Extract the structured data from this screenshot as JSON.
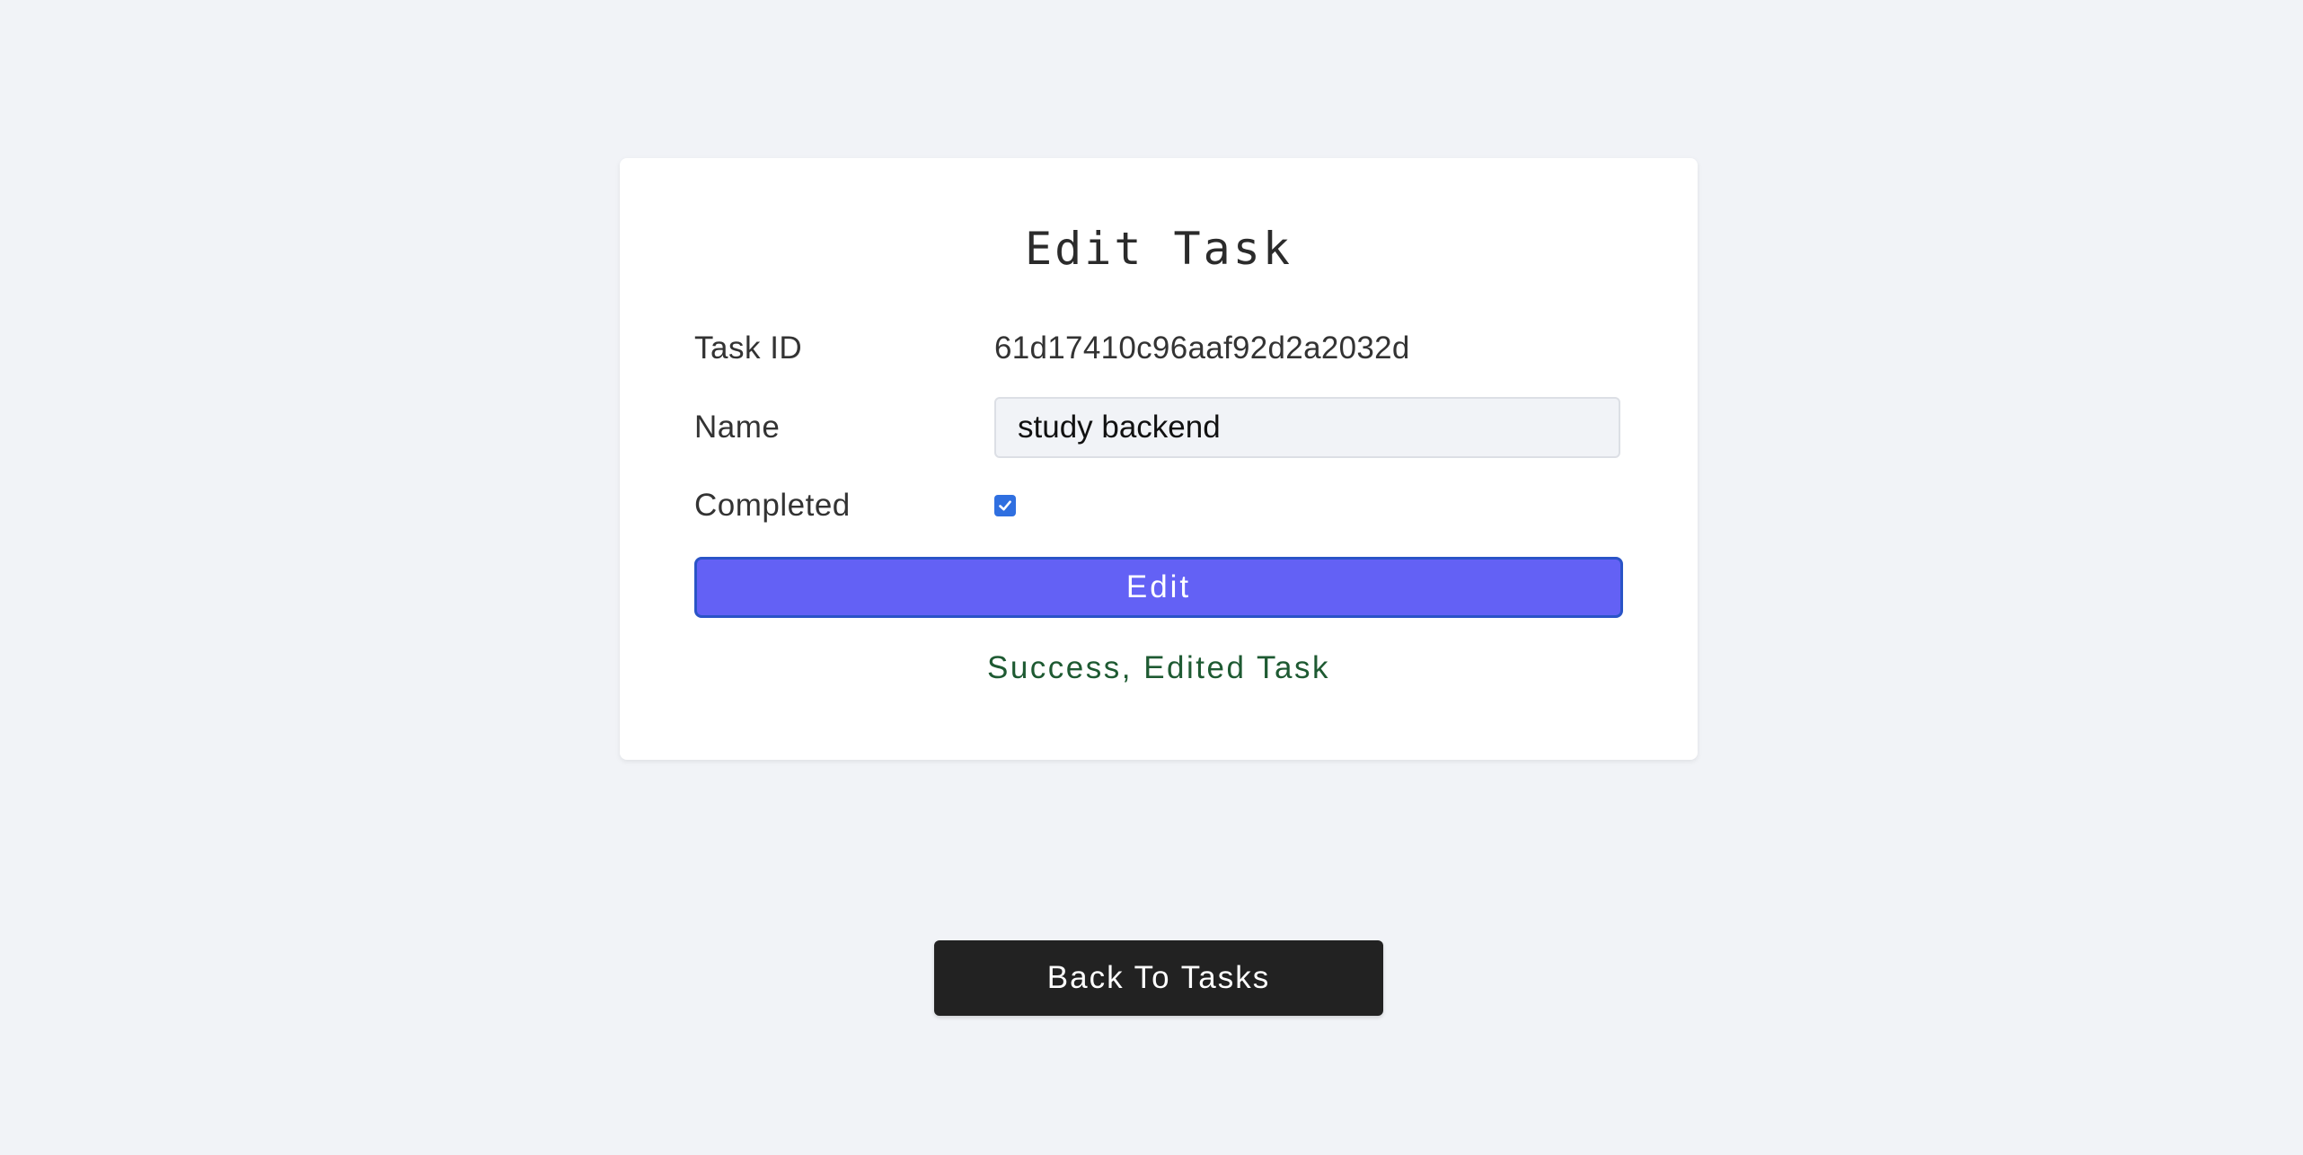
{
  "form": {
    "title": "Edit Task",
    "task_id_label": "Task ID",
    "task_id_value": "61d17410c96aaf92d2a2032d",
    "name_label": "Name",
    "name_value": "study backend",
    "completed_label": "Completed",
    "completed_checked": true,
    "edit_button_label": "Edit",
    "status_message": "Success, Edited Task"
  },
  "navigation": {
    "back_button_label": "Back To Tasks"
  },
  "colors": {
    "page_background": "#f1f3f7",
    "edit_button": "#6361f5",
    "checkbox": "#2f6fe0",
    "success_text": "#1e5a32",
    "back_button": "#222222"
  },
  "icons": {
    "checkbox": "check-icon"
  }
}
